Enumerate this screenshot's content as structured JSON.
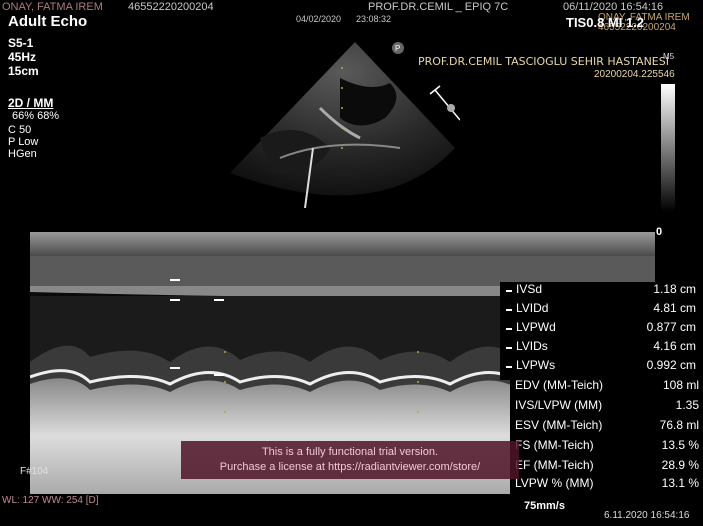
{
  "header": {
    "patient_name": "ONAY, FATMA IREM",
    "patient_id": "46552220200204",
    "physician": "PROF.DR.CEMIL _  EPIQ 7C",
    "datetime": "06/11/2020  16:54:16",
    "patient_name_overlay": "ONAY, FATMA IREM",
    "patient_id_overlay": "46552220200204",
    "tis": "TIS0.8  MI 1.2",
    "scan_date": "04/02/2020",
    "scan_time": "23:08:32"
  },
  "preset": "Adult Echo",
  "params": [
    "S5-1",
    "45Hz",
    "15cm"
  ],
  "mode_label": "2D / MM",
  "gains": "66%    68%",
  "settings": [
    "C 50",
    "P Low",
    "HGen"
  ],
  "hospital": "PROF.DR.CEMIL TASCIOGLU SEHIR HASTANESI",
  "hospital_id": "20200204.225546",
  "ms_label": "M5",
  "zero_label": "0",
  "frame_label": "F#104",
  "wl_ww": "WL: 127  WW: 254 [D]",
  "speed": "75mm/s",
  "bottom_datetime": "6.11.2020  16:54:16",
  "measurements": [
    {
      "name": "IVSd",
      "value": "1.18 cm"
    },
    {
      "name": "LVIDd",
      "value": "4.81 cm"
    },
    {
      "name": "LVPWd",
      "value": "0.877 cm"
    },
    {
      "name": "LVIDs",
      "value": "4.16 cm"
    },
    {
      "name": "LVPWs",
      "value": "0.992 cm"
    }
  ],
  "calculations": [
    {
      "name": "EDV (MM-Teich)",
      "value": "108 ml"
    },
    {
      "name": "IVS/LVPW (MM)",
      "value": "1.35"
    },
    {
      "name": "ESV (MM-Teich)",
      "value": "76.8 ml"
    },
    {
      "name": "FS (MM-Teich)",
      "value": "13.5 %"
    },
    {
      "name": "EF (MM-Teich)",
      "value": "28.9 %"
    },
    {
      "name": "LVPW % (MM)",
      "value": "13.1 %"
    }
  ],
  "trial_banner": {
    "line1": "This is a fully functional trial version.",
    "line2": "Purchase a license at https://radiantviewer.com/store/"
  }
}
